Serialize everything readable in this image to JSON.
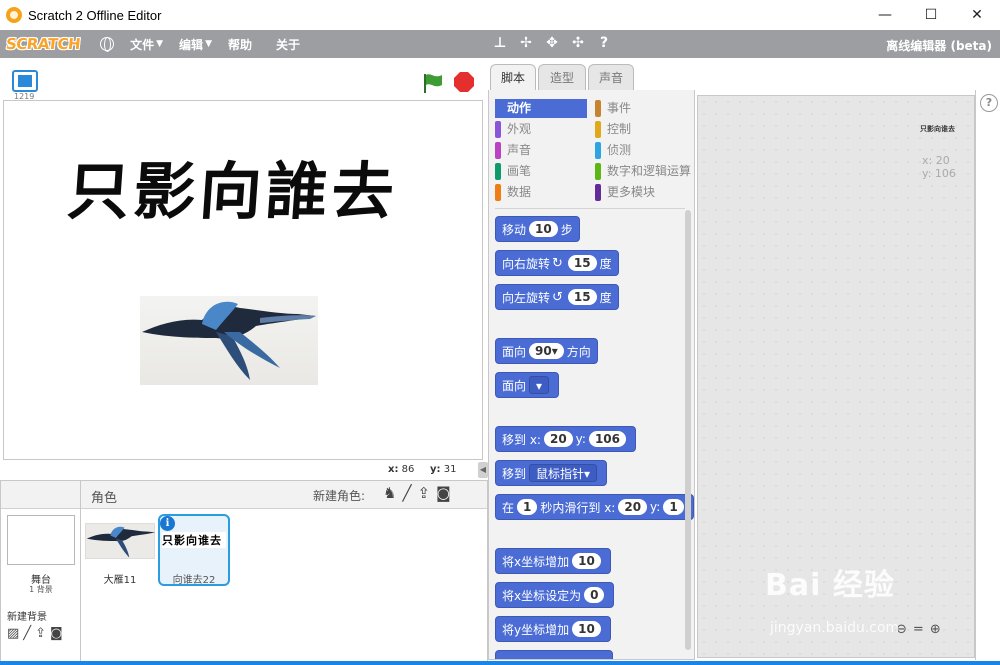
{
  "window": {
    "title": "Scratch 2 Offline Editor",
    "minimize": "—",
    "maximize": "☐",
    "close": "✕"
  },
  "menubar": {
    "logo": "SCRATCH",
    "file": "文件",
    "edit": "编辑",
    "help": "帮助",
    "about": "关于",
    "editor_label": "离线编辑器 (beta)"
  },
  "stage": {
    "version": "1219",
    "text": "只影向誰去",
    "mouse_x_label": "x:",
    "mouse_x": "86",
    "mouse_y_label": "y:",
    "mouse_y": "31"
  },
  "sprites_pane": {
    "stage_name": "舞台",
    "stage_count": "1 背景",
    "new_backdrop": "新建背景",
    "sprites_label": "角色",
    "new_sprite": "新建角色:",
    "sprites": [
      {
        "name": "大雁11"
      },
      {
        "name": "向谁去22",
        "thumb_text": "只影向谁去",
        "info": "i"
      }
    ]
  },
  "tabs": [
    "脚本",
    "造型",
    "声音"
  ],
  "categories": [
    {
      "label": "动作",
      "color": "#4a6cd4",
      "active": true
    },
    {
      "label": "事件",
      "color": "#c88330"
    },
    {
      "label": "外观",
      "color": "#8a55d7"
    },
    {
      "label": "控制",
      "color": "#e1a91a"
    },
    {
      "label": "声音",
      "color": "#bb42c3"
    },
    {
      "label": "侦测",
      "color": "#2ca5e2"
    },
    {
      "label": "画笔",
      "color": "#0e9a6c"
    },
    {
      "label": "数字和逻辑运算",
      "color": "#5cb712"
    },
    {
      "label": "数据",
      "color": "#ee7d16"
    },
    {
      "label": "更多模块",
      "color": "#632d99"
    }
  ],
  "blocks": {
    "move": {
      "pre": "移动",
      "val": "10",
      "post": "步"
    },
    "turn_right": {
      "pre": "向右旋转",
      "icon": "↻",
      "val": "15",
      "post": "度"
    },
    "turn_left": {
      "pre": "向左旋转",
      "icon": "↺",
      "val": "15",
      "post": "度"
    },
    "point_dir": {
      "pre": "面向",
      "val": "90▾",
      "post": "方向"
    },
    "point_towards": {
      "pre": "面向",
      "val": "▾"
    },
    "goto_xy": {
      "pre": "移到 x:",
      "x": "20",
      "ymid": "y:",
      "y": "106"
    },
    "goto": {
      "pre": "移到",
      "val": "鼠标指针▾"
    },
    "glide": {
      "pre": "在",
      "val": "1",
      "mid": "秒内滑行到 x:",
      "x": "20",
      "ymid": "y:",
      "y": "1"
    },
    "change_x": {
      "pre": "将x坐标增加",
      "val": "10"
    },
    "set_x": {
      "pre": "将x坐标设定为",
      "val": "0"
    },
    "change_y": {
      "pre": "将y坐标增加",
      "val": "10"
    }
  },
  "script_area": {
    "sprite_text": "只影向谁去",
    "x": "x: 20",
    "y": "y: 106",
    "help": "?"
  },
  "watermark": {
    "main": "Bai 经验",
    "sub": "jingyan.baidu.com"
  }
}
